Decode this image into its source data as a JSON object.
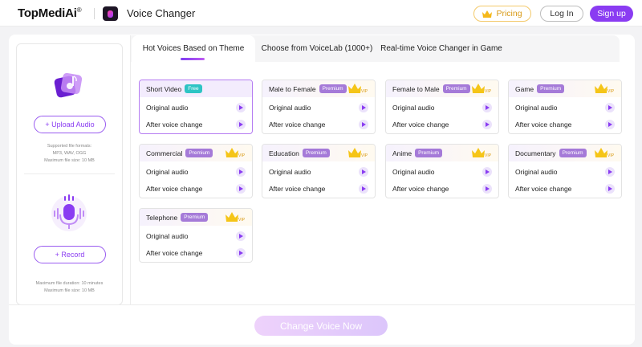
{
  "header": {
    "logo_text": "TopMediAi",
    "logo_reg": "®",
    "app_title": "Voice Changer",
    "pricing_label": "Pricing",
    "login_label": "Log In",
    "signup_label": "Sign up"
  },
  "left": {
    "upload_label": "+ Upload Audio",
    "upload_note": [
      "Supported file formats:",
      "MP3, WAV, OGG",
      "Maximum file size: 10 MB"
    ],
    "record_label": "+ Record",
    "record_note": [
      "Maximum file duration: 10 minutes",
      "Maximum file size: 10 MB"
    ]
  },
  "tabs": [
    {
      "label": "Hot Voices Based on Theme",
      "active": true
    },
    {
      "label": "Choose from VoiceLab (1000+)",
      "active": false
    },
    {
      "label": "Real-time Voice Changer in Game",
      "active": false
    }
  ],
  "row_labels": {
    "original": "Original audio",
    "after": "After voice change"
  },
  "cards": [
    {
      "title": "Short Video",
      "badge": "Free",
      "vip": false,
      "selected": true
    },
    {
      "title": "Male to Female",
      "badge": "Premium",
      "vip": true,
      "selected": false
    },
    {
      "title": "Female to Male",
      "badge": "Premium",
      "vip": true,
      "selected": false
    },
    {
      "title": "Game",
      "badge": "Premium",
      "vip": true,
      "selected": false
    },
    {
      "title": "Commercial",
      "badge": "Premium",
      "vip": true,
      "selected": false
    },
    {
      "title": "Education",
      "badge": "Premium",
      "vip": true,
      "selected": false
    },
    {
      "title": "Anime",
      "badge": "Premium",
      "vip": true,
      "selected": false
    },
    {
      "title": "Documentary",
      "badge": "Premium",
      "vip": true,
      "selected": false
    },
    {
      "title": "Telephone",
      "badge": "Premium",
      "vip": true,
      "selected": false
    }
  ],
  "vip_text": "VIP",
  "action_label": "Change Voice Now",
  "colors": {
    "accent": "#8a3cf2",
    "premium_badge": "#a57ad8",
    "free_badge": "#2ec4c4",
    "crown": "#f5c518"
  }
}
